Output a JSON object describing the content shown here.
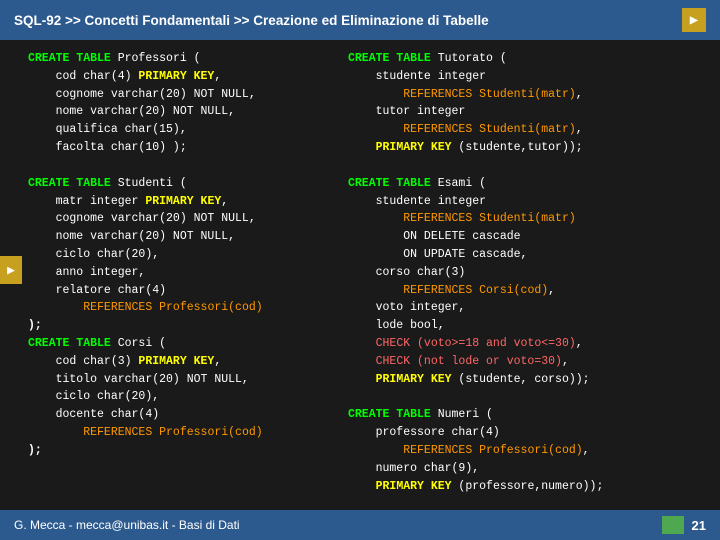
{
  "header": {
    "title": "SQL-92 >> Concetti Fondamentali >> Creazione ed Eliminazione di Tabelle",
    "arrow_symbol": "▶"
  },
  "left_arrow": "▶",
  "content": {
    "col_left_code": "CREATE TABLE Professori (\n    cod char(4) PRIMARY KEY,\n    cognome varchar(20) NOT NULL,\n    nome varchar(20) NOT NULL,\n    qualifica char(15),\n    facolta char(10) );\n\nCREATE TABLE Studenti (\n    matr integer PRIMARY KEY,\n    cognome varchar(20) NOT NULL,\n    nome varchar(20) NOT NULL,\n    ciclo char(20),\n    anno integer,\n    relatore char(4)\n        REFERENCES Professori(cod)\n);\nCREATE TABLE Corsi (\n    cod char(3) PRIMARY KEY,\n    titolo varchar(20) NOT NULL,\n    ciclo char(20),\n    docente char(4)\n        REFERENCES Professori(cod)\n);",
    "col_right_code": "CREATE TABLE Tutorato (\n    studente integer\n        REFERENCES Studenti(matr),\n    tutor integer\n        REFERENCES Studenti(matr),\n    PRIMARY KEY (studente,tutor));\n\nCREATE TABLE Esami (\n    studente integer\n        REFERENCES Studenti(matr)\n        ON DELETE cascade\n        ON UPDATE cascade,\n    corso char(3)\n        REFERENCES Corsi(cod),\n    voto integer,\n    lode bool,\n    CHECK (voto>=18 and voto<=30),\n    CHECK (not lode or voto=30),\n    PRIMARY KEY (studente, corso));\n\nCREATE TABLE Numeri (\n    professore char(4)\n        REFERENCES Professori(cod),\n    numero char(9),\n    PRIMARY KEY (professore,numero));"
  },
  "footer": {
    "text": "G. Mecca - mecca@unibas.it - Basi di Dati",
    "page_number": "21",
    "box_color": "#4fa84f"
  }
}
